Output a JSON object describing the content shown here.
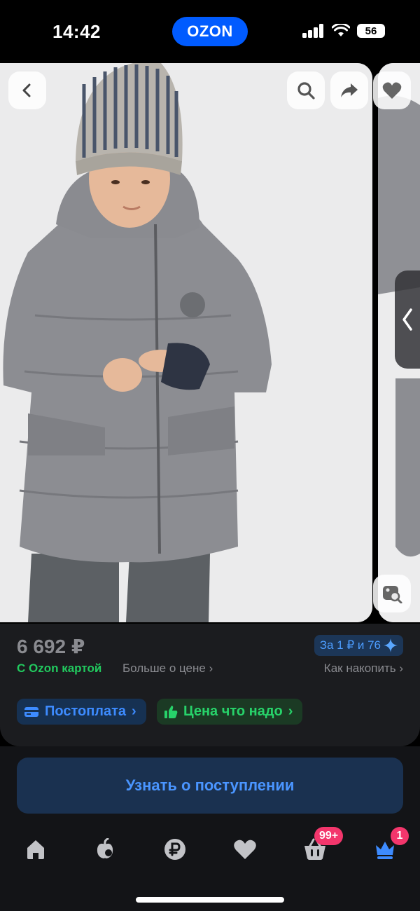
{
  "status_bar": {
    "time": "14:42",
    "app_pill": "OZON",
    "battery": "56"
  },
  "gallery": {
    "back_icon": "chevron-left-icon",
    "search_icon": "search-icon",
    "share_icon": "share-arrow-icon",
    "favorite_icon": "heart-icon",
    "next_image_icon": "chevron-left-icon",
    "visual_search_icon": "image-search-icon"
  },
  "product": {
    "price": "6 692 ₽",
    "bonus_text": "За 1 ₽ и 76",
    "ozon_card_label": "С Ozon картой",
    "more_about_price": "Больше о цене",
    "how_to_accumulate": "Как накопить",
    "badges": [
      {
        "label": "Постоплата",
        "icon": "wallet-icon"
      },
      {
        "label": "Цена что надо",
        "icon": "thumbs-up-icon"
      }
    ],
    "notify_button": "Узнать о поступлении"
  },
  "tabbar": {
    "items": [
      {
        "name": "home",
        "icon": "home-icon"
      },
      {
        "name": "fresh",
        "icon": "fresh-icon"
      },
      {
        "name": "finance",
        "icon": "ruble-icon"
      },
      {
        "name": "favorites",
        "icon": "heart-icon"
      },
      {
        "name": "cart",
        "icon": "cart-icon",
        "badge": "99+"
      },
      {
        "name": "profile",
        "icon": "crown-icon",
        "badge": "1"
      }
    ]
  },
  "colors": {
    "accent": "#005bff",
    "green": "#21c95e",
    "badge_pink": "#f3366c",
    "panel": "#1b1c1f"
  }
}
